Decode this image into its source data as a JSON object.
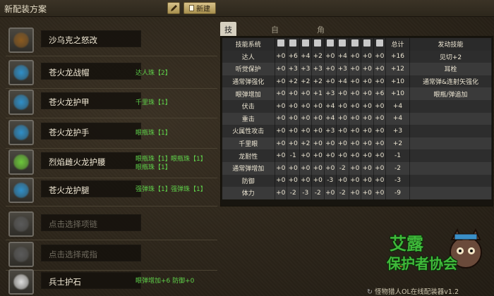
{
  "window": {
    "title": "新配装方案",
    "new_label": "新建"
  },
  "slots": [
    {
      "name": "沙乌克之怒改",
      "icon": "weapon-icon",
      "color": "#8a5a20",
      "deco": []
    },
    {
      "name": "苍火龙战帽",
      "icon": "helmet-icon",
      "color": "#2f8fc8",
      "deco": [
        "达人珠【2】"
      ]
    },
    {
      "name": "苍火龙护甲",
      "icon": "chest-armor-icon",
      "color": "#2f8fc8",
      "deco": [
        "千里珠【1】"
      ]
    },
    {
      "name": "苍火龙护手",
      "icon": "gauntlet-icon",
      "color": "#2f8fc8",
      "deco": [
        "眼瓶珠【1】"
      ]
    },
    {
      "name": "烈焰雌火龙护腰",
      "icon": "waist-armor-icon",
      "color": "#6cc83a",
      "deco": [
        "眼瓶珠【1】",
        "眼瓶珠【1】",
        "眼瓶珠【1】"
      ]
    },
    {
      "name": "苍火龙护腿",
      "icon": "leg-armor-icon",
      "color": "#2f8fc8",
      "deco": [
        "强弹珠【1】",
        "强弹珠【1】"
      ]
    },
    {
      "name": "点击选择项链",
      "icon": "necklace-icon",
      "color": "#5a5a5a",
      "deco": [],
      "empty": true
    },
    {
      "name": "点击选择戒指",
      "icon": "ring-icon",
      "color": "#5a5a5a",
      "deco": [],
      "empty": true
    },
    {
      "name": "兵士护石",
      "icon": "charm-icon",
      "color": "#dcdcdc",
      "deco": [
        "眼弹增加+6 防御+0"
      ]
    }
  ],
  "tabs": [
    {
      "label": "技能详情",
      "active": true
    },
    {
      "label": "自动配装"
    },
    {
      "label": "角色信息"
    }
  ],
  "table": {
    "col_skill": "技能系统",
    "col_total": "总计",
    "col_active": "发动技能",
    "part_icons": [
      "weapon-icon",
      "helmet-icon",
      "chest-armor-icon",
      "gauntlet-icon",
      "waist-armor-icon",
      "leg-armor-icon",
      "necklace-icon",
      "ring-icon",
      "charm-icon"
    ],
    "rows": [
      {
        "name": "达人",
        "v": [
          "+0",
          "+6",
          "+4",
          "+2",
          "+0",
          "+4",
          "+0",
          "+0",
          "+0"
        ],
        "total": "+16",
        "skill": "见切+2"
      },
      {
        "name": "听觉保护",
        "v": [
          "+0",
          "+3",
          "+3",
          "+3",
          "+0",
          "+3",
          "+0",
          "+0",
          "+0"
        ],
        "total": "+12",
        "skill": "耳栓"
      },
      {
        "name": "通常弹强化",
        "v": [
          "+0",
          "+2",
          "+2",
          "+2",
          "+0",
          "+4",
          "+0",
          "+0",
          "+0"
        ],
        "total": "+10",
        "skill": "通常弹&连射矢强化"
      },
      {
        "name": "眼弹增加",
        "v": [
          "+0",
          "+0",
          "+0",
          "+1",
          "+3",
          "+0",
          "+0",
          "+0",
          "+6"
        ],
        "total": "+10",
        "skill": "眼瓶/弹追加"
      },
      {
        "name": "伏击",
        "v": [
          "+0",
          "+0",
          "+0",
          "+0",
          "+4",
          "+0",
          "+0",
          "+0",
          "+0"
        ],
        "total": "+4",
        "skill": ""
      },
      {
        "name": "重击",
        "v": [
          "+0",
          "+0",
          "+0",
          "+0",
          "+4",
          "+0",
          "+0",
          "+0",
          "+0"
        ],
        "total": "+4",
        "skill": ""
      },
      {
        "name": "火属性攻击",
        "v": [
          "+0",
          "+0",
          "+0",
          "+0",
          "+3",
          "+0",
          "+0",
          "+0",
          "+0"
        ],
        "total": "+3",
        "skill": ""
      },
      {
        "name": "千里眼",
        "v": [
          "+0",
          "+0",
          "+2",
          "+0",
          "+0",
          "+0",
          "+0",
          "+0",
          "+0"
        ],
        "total": "+2",
        "skill": ""
      },
      {
        "name": "龙耐性",
        "v": [
          "+0",
          "-1",
          "+0",
          "+0",
          "+0",
          "+0",
          "+0",
          "+0",
          "+0"
        ],
        "total": "-1",
        "skill": ""
      },
      {
        "name": "通常弹增加",
        "v": [
          "+0",
          "+0",
          "+0",
          "+0",
          "+0",
          "-2",
          "+0",
          "+0",
          "+0"
        ],
        "total": "-2",
        "skill": ""
      },
      {
        "name": "防御",
        "v": [
          "+0",
          "+0",
          "+0",
          "+0",
          "-3",
          "+0",
          "+0",
          "+0",
          "+0"
        ],
        "total": "-3",
        "skill": ""
      },
      {
        "name": "体力",
        "v": [
          "+0",
          "-2",
          "-3",
          "-2",
          "+0",
          "-2",
          "+0",
          "+0",
          "+0"
        ],
        "total": "-9",
        "skill": ""
      }
    ]
  },
  "watermark": {
    "line1": "艾露",
    "line2": "保护者协会",
    "sub": "怪物猎人OL在线配装器v1.2"
  }
}
